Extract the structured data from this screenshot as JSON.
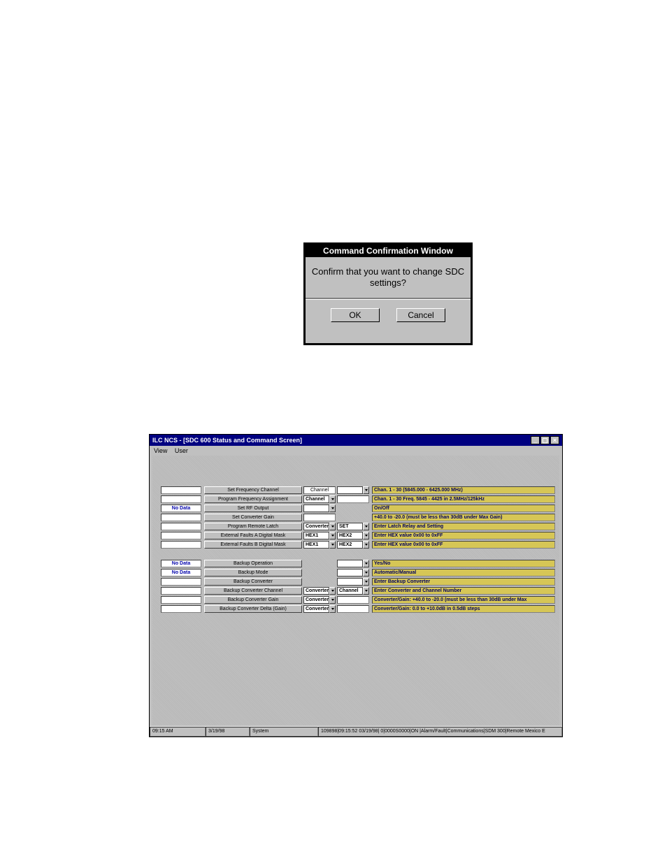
{
  "dialog": {
    "title": "Command Confirmation Window",
    "text": "Confirm that you want to change SDC settings?",
    "ok": "OK",
    "cancel": "Cancel"
  },
  "app": {
    "title": "ILC NCS - [SDC 600 Status and Command Screen]",
    "menu": {
      "view": "View",
      "user": "User"
    },
    "no_data": "No Data",
    "rows1": [
      {
        "label": "Set Frequency Channel",
        "c1": "Channel",
        "c2": "",
        "dd2": true,
        "hint": "Chan. 1 - 30   (5845.000 - 6425.000 MHz)"
      },
      {
        "label": "Program Frequency Assignment",
        "c1": "Channel",
        "dd1": true,
        "c2": "",
        "plain2": true,
        "hint": "Chan. 1 - 30    Freq. 5845 - 4425 in 2.5MHz/125kHz"
      },
      {
        "label": "Set RF Output",
        "no_data": true,
        "c1": "",
        "dd1": true,
        "hint": "On/Off"
      },
      {
        "label": "Set Converter Gain",
        "c1": "",
        "plain1": true,
        "hint": "+40.0 to -20.0 (must be less than 30dB under Max Gain)"
      },
      {
        "label": "Program Remote Latch",
        "c1": "Converter",
        "dd1": true,
        "c2": "SET",
        "dd2": true,
        "hint": "Enter Latch Relay and Setting"
      },
      {
        "label": "External Faults A Digital Mask",
        "c1": "HEX1",
        "dd1": true,
        "c2": "HEX2",
        "dd2": true,
        "hint": "Enter HEX value 0x00 to 0xFF"
      },
      {
        "label": "External Faults B Digital Mask",
        "c1": "HEX1",
        "dd1": true,
        "c2": "HEX2",
        "dd2": true,
        "hint": "Enter HEX value 0x00 to 0xFF"
      }
    ],
    "rows2": [
      {
        "label": "Backup Operation",
        "no_data": true,
        "c2": "",
        "dd2": true,
        "hint": "Yes/No"
      },
      {
        "label": "Backup Mode",
        "no_data": true,
        "c2": "",
        "dd2": true,
        "hint": "Automatic/Manual"
      },
      {
        "label": "Backup Converter",
        "c2": "",
        "dd2": true,
        "hint": "Enter Backup Converter"
      },
      {
        "label": "Backup Converter Channel",
        "c1": "Converter",
        "dd1": true,
        "c2": "Channel",
        "dd2": true,
        "hint": "Enter Converter and Channel Number"
      },
      {
        "label": "Backup Converter Gain",
        "c1": "Converter",
        "dd1": true,
        "c2": "",
        "plain2": true,
        "hint": "Converter/Gain: +40.0 to -20.0 (must be less than 30dB under Max"
      },
      {
        "label": "Backup Converter Delta (Gain)",
        "c1": "Converter",
        "dd1": true,
        "c2": "",
        "plain2": true,
        "hint": "Converter/Gain: 0.0 to +10.0dB in 0.5dB steps"
      }
    ],
    "statusbar": {
      "time": "09:15 AM",
      "date": "3/19/98",
      "user": "System",
      "log": "109898|09:15:52 03/19/98| 0|0000S0000|ON  |Alarm/Fault|Communications|SDM 300|Remote Mexico E"
    }
  }
}
